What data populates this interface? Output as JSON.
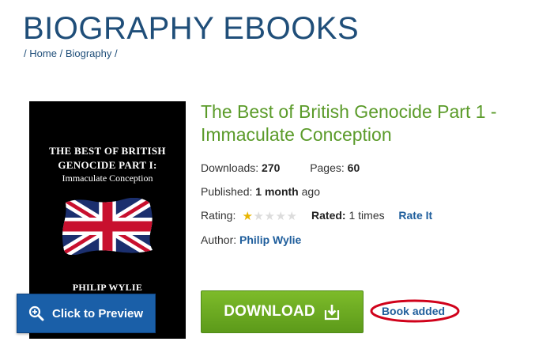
{
  "page": {
    "title": "BIOGRAPHY EBOOKS"
  },
  "breadcrumb": {
    "sep": "/",
    "items": [
      "Home",
      "Biography"
    ]
  },
  "cover": {
    "title_line1": "THE BEST OF BRITISH",
    "title_line2": "GENOCIDE PART I:",
    "subtitle": "Immaculate Conception",
    "author": "PHILIP WYLIE"
  },
  "preview": {
    "label": "Click to Preview",
    "icon": "magnifier-plus-icon"
  },
  "book": {
    "title": "The Best of British Genocide Part 1 - Immaculate Conception",
    "downloads_label": "Downloads:",
    "downloads_value": "270",
    "pages_label": "Pages:",
    "pages_value": "60",
    "published_label": "Published:",
    "published_value": "1 month",
    "published_suffix": "ago",
    "rating_label": "Rating:",
    "rating_stars": 1,
    "rating_max": 5,
    "rated_label": "Rated:",
    "rated_value": "1 times",
    "rate_it": "Rate It",
    "author_label": "Author:",
    "author_name": "Philip Wylie"
  },
  "download": {
    "label": "DOWNLOAD",
    "icon": "download-tray-icon"
  },
  "book_added": {
    "label": "Book added",
    "highlight_color": "#d0021b"
  },
  "colors": {
    "heading": "#1f4e79",
    "title_green": "#5b9b2a",
    "link": "#1f5e9c",
    "button_green": "#6aaa22",
    "preview_blue": "#1a5fa8",
    "star": "#e8b500"
  }
}
